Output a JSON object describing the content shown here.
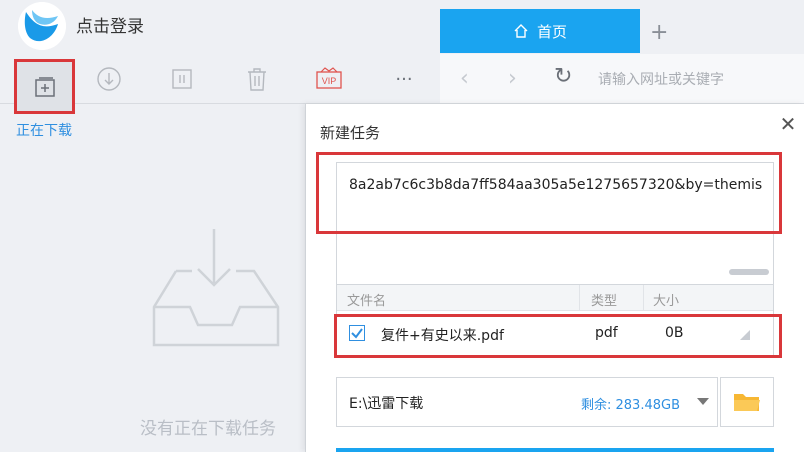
{
  "login": {
    "label": "点击登录"
  },
  "toolbar": {
    "buttons": [
      {
        "icon": "new-task-icon"
      },
      {
        "icon": "download-start-icon"
      },
      {
        "icon": "pause-icon"
      },
      {
        "icon": "trash-icon"
      },
      {
        "icon": "vip-icon",
        "label": "VIP"
      },
      {
        "icon": "more-icon",
        "label": "···"
      }
    ]
  },
  "left": {
    "active_tab": "正在下载",
    "empty_message": "没有正在下载任务"
  },
  "browser": {
    "home_tab": "首页",
    "new_tab_symbol": "+",
    "url_placeholder": "请输入网址或关键字",
    "back": "‹",
    "forward": "›",
    "reload": "↻"
  },
  "dialog": {
    "title": "新建任务",
    "close": "✕",
    "url_value": "8a2ab7c6c3b8da7ff584aa305a5e1275657320&by=themis",
    "table": {
      "headers": [
        "文件名",
        "类型",
        "大小"
      ],
      "rows": [
        {
          "checked": true,
          "name": "复件+有史以来.pdf",
          "type": "pdf",
          "size": "0B"
        }
      ]
    },
    "save_path": "E:\\迅雷下载",
    "free_space": "剩余: 283.48GB"
  },
  "colors": {
    "accent": "#1aa4f0",
    "highlight_red": "#d9373a",
    "link_blue": "#2f8fe0"
  }
}
